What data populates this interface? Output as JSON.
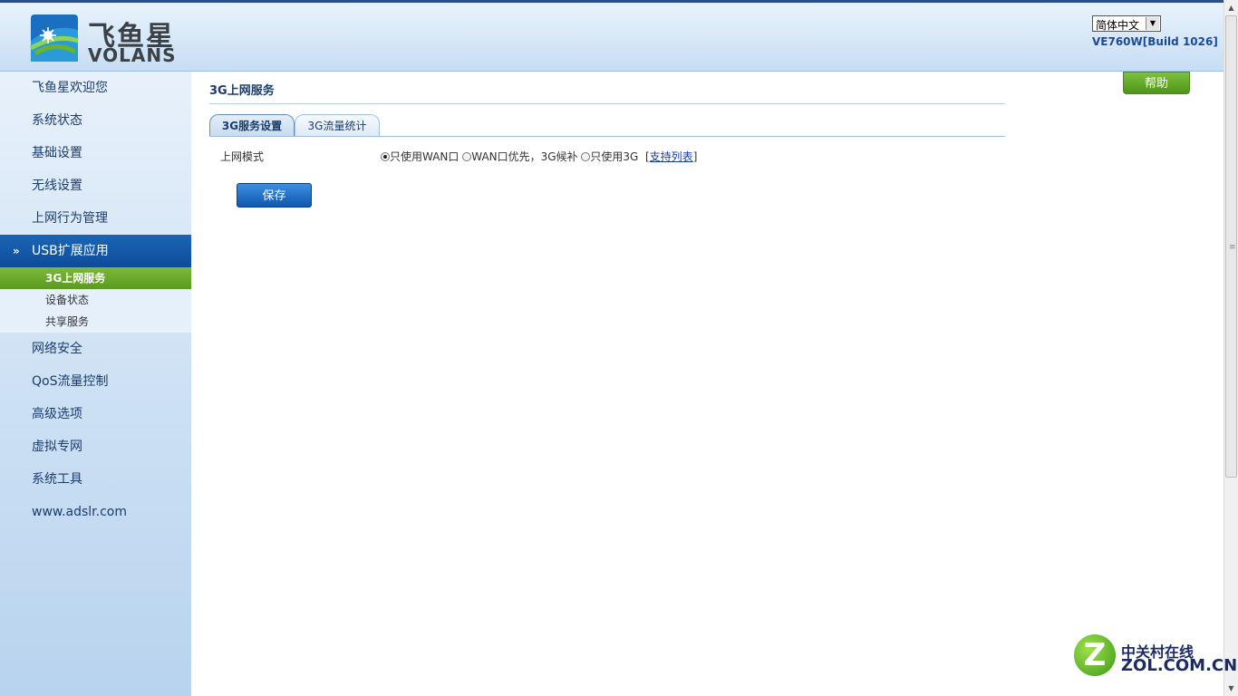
{
  "header": {
    "logo_cn": "飞鱼星",
    "logo_en": "VOLANS",
    "language_selected": "简体中文",
    "version": "VE760W[Build 1026]"
  },
  "sidebar": {
    "items": [
      {
        "label": "飞鱼星欢迎您"
      },
      {
        "label": "系统状态"
      },
      {
        "label": "基础设置"
      },
      {
        "label": "无线设置"
      },
      {
        "label": "上网行为管理"
      },
      {
        "label": "USB扩展应用",
        "expanded": true
      },
      {
        "label": "网络安全"
      },
      {
        "label": "QoS流量控制"
      },
      {
        "label": "高级选项"
      },
      {
        "label": "虚拟专网"
      },
      {
        "label": "系统工具"
      },
      {
        "label": "www.adslr.com"
      }
    ],
    "sub_items": [
      {
        "label": "3G上网服务",
        "active": true
      },
      {
        "label": "设备状态"
      },
      {
        "label": "共享服务"
      }
    ],
    "expand_glyph": "»"
  },
  "main": {
    "title": "3G上网服务",
    "help_label": "帮助",
    "tabs": [
      {
        "label": "3G服务设置",
        "active": true
      },
      {
        "label": "3G流量统计"
      }
    ],
    "mode_label": "上网模式",
    "options": [
      {
        "label": "只使用WAN口",
        "checked": true
      },
      {
        "label": "WAN口优先，3G候补"
      },
      {
        "label": "只使用3G"
      }
    ],
    "support_list_open": "[",
    "support_list_label": "支持列表",
    "support_list_close": "]",
    "save_label": "保存"
  },
  "watermark": {
    "icon_letter": "Z",
    "cn": "中关村在线",
    "en": "ZOL.COM.CN"
  },
  "colors": {
    "accent_blue": "#0d4d98",
    "accent_green": "#5a9a1e",
    "title_blue": "#1a3d6e"
  }
}
